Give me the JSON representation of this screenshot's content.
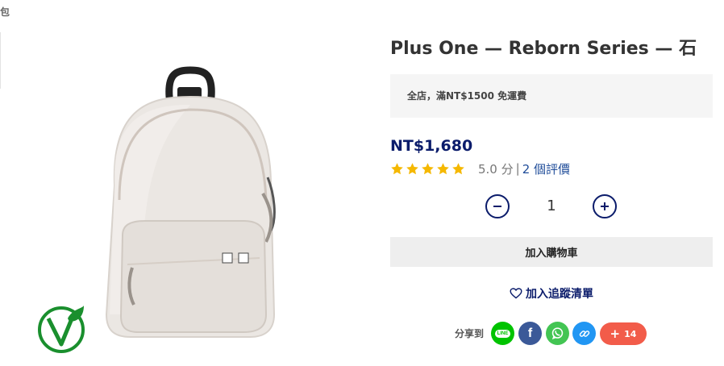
{
  "breadcrumb": {
    "text": "包"
  },
  "product": {
    "title": "Plus One — Reborn Series — 石",
    "promo": "全店，滿NT$1500 免運費",
    "price": "NT$1,680",
    "rating": {
      "stars": 5,
      "score": "5.0 分",
      "separator": "|",
      "reviews": "2 個評價"
    },
    "quantity": "1",
    "image_icon": "white-backpack-image",
    "badge_icon": "vegan-v-leaf-icon"
  },
  "actions": {
    "add_to_cart": "加入購物車",
    "wishlist": "加入追蹤清單"
  },
  "share": {
    "label": "分享到",
    "line_icon": "LINE",
    "more_count": "14",
    "more_icon": "+"
  },
  "colors": {
    "brand_navy": "#0b1c6b",
    "star": "#f5b800",
    "line": "#00c300",
    "facebook": "#3b5998",
    "whatsapp": "#43c553",
    "link": "#2196f3",
    "more": "#f25c4a",
    "vegan_green": "#1a8f2e"
  }
}
